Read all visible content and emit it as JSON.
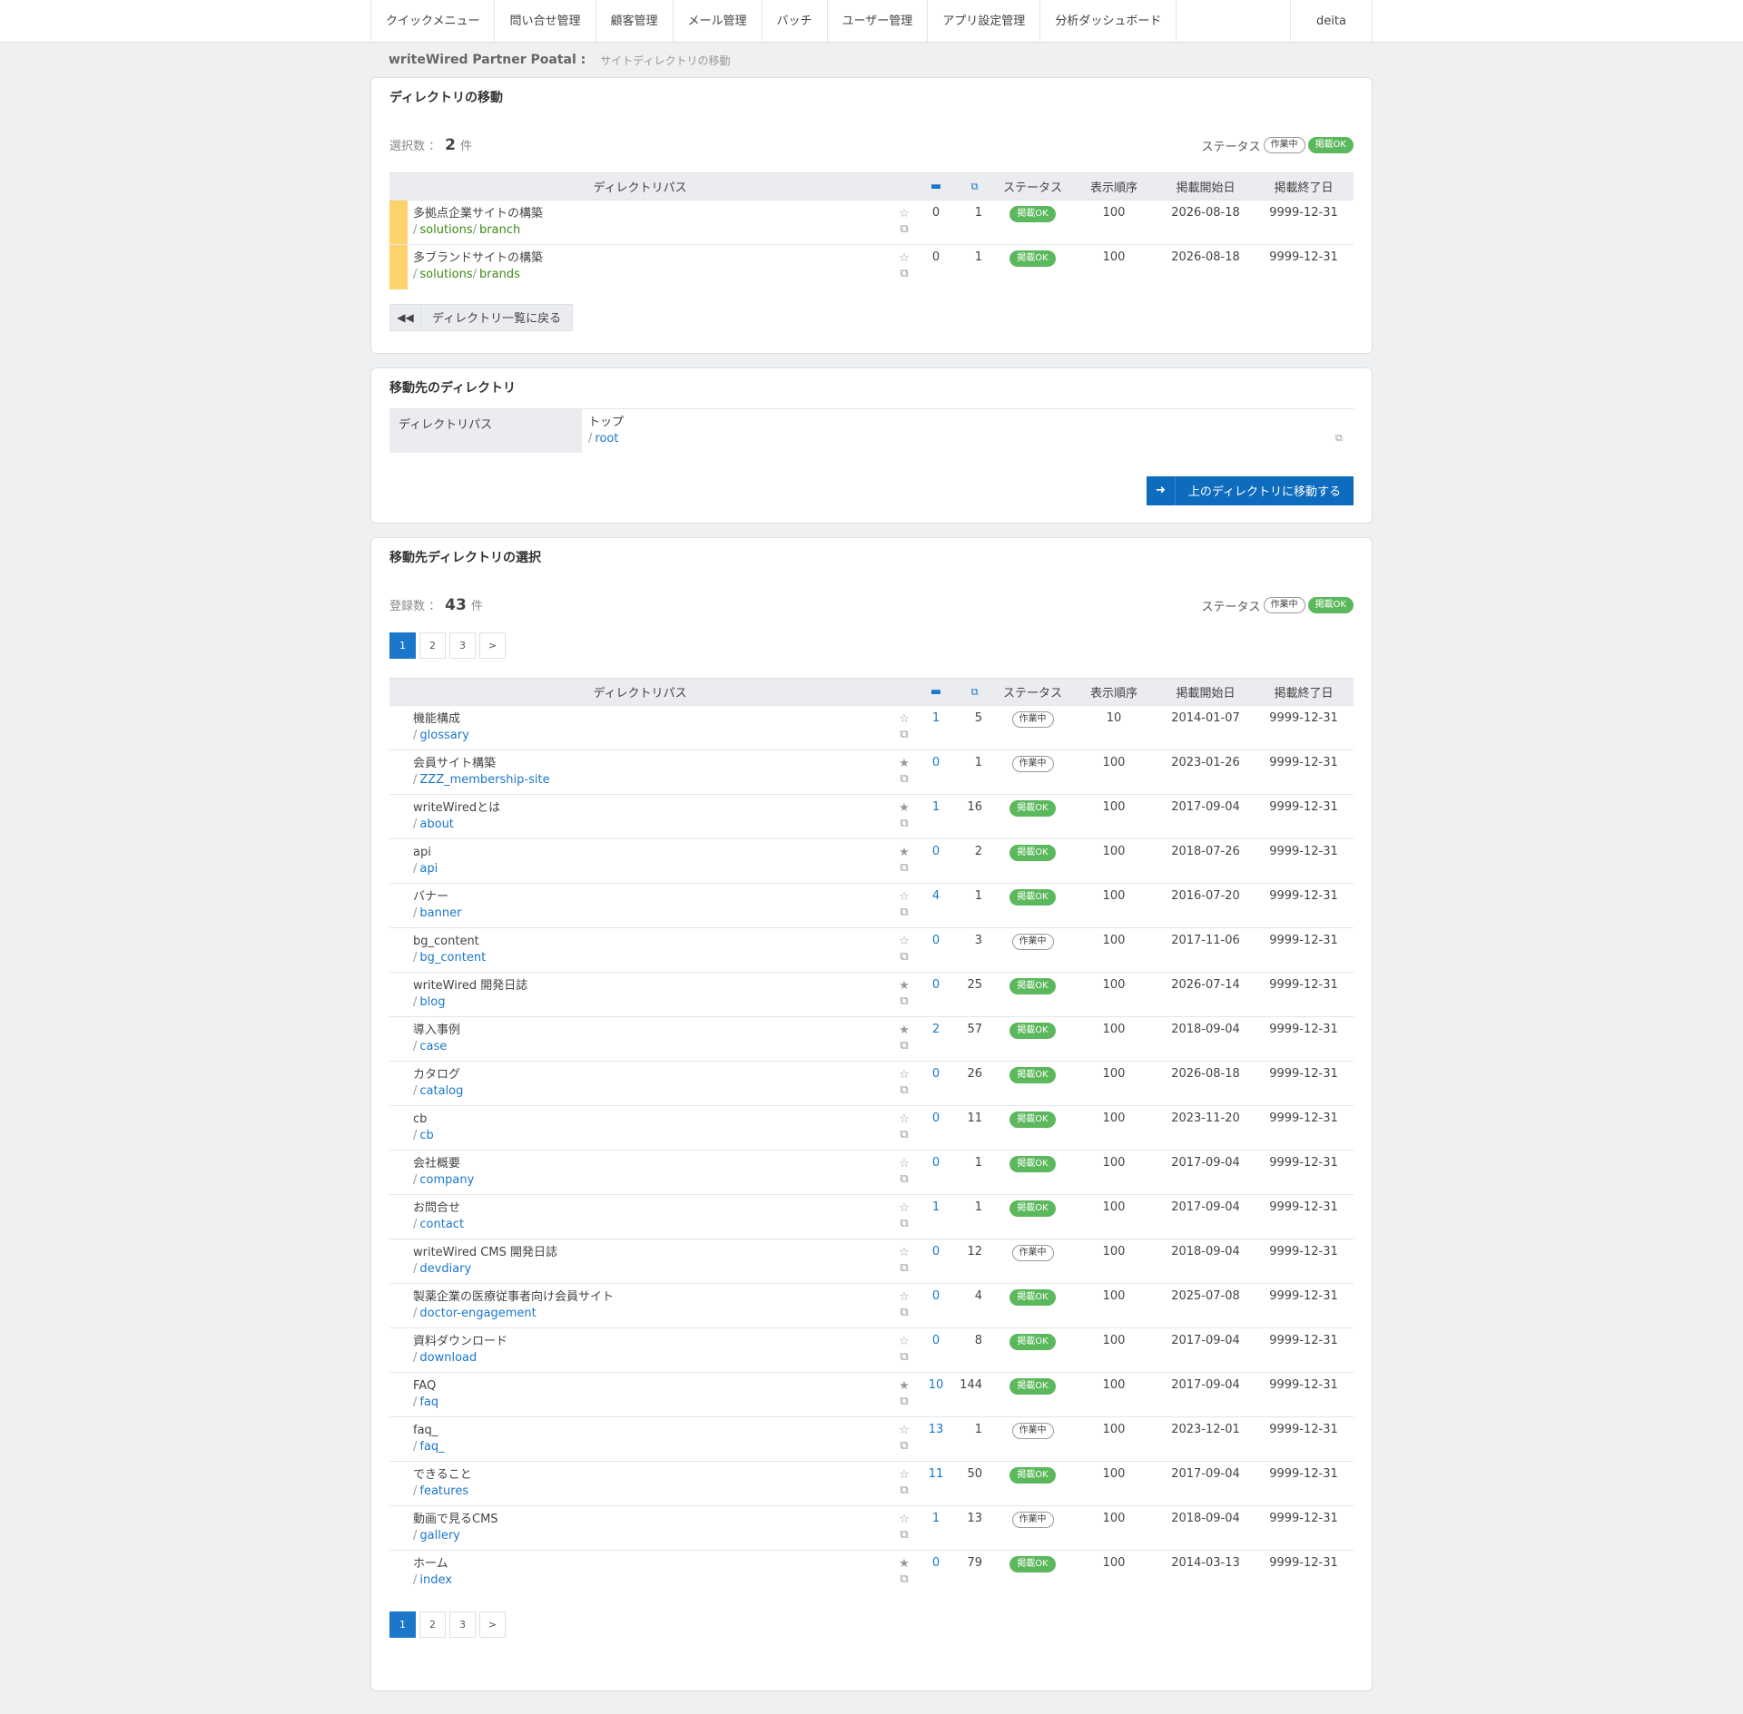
{
  "nav": {
    "items": [
      {
        "label": "クイックメニュー"
      },
      {
        "label": "問い合せ管理"
      },
      {
        "label": "顧客管理"
      },
      {
        "label": "メール管理"
      },
      {
        "label": "バッチ"
      },
      {
        "label": "ユーザー管理"
      },
      {
        "label": "アプリ設定管理"
      },
      {
        "label": "分析ダッシュボード"
      }
    ],
    "user": "deita"
  },
  "breadcrumb": {
    "site": "writeWired Partner Poatal :",
    "page": "サイトディレクトリの移動"
  },
  "status_legend": {
    "label": "ステータス",
    "wip": "作業中",
    "ok": "掲載OK"
  },
  "columns": {
    "path": "ディレクトリパス",
    "status": "ステータス",
    "order": "表示順序",
    "start": "掲載開始日",
    "end": "掲載終了日"
  },
  "move_panel": {
    "title": "ディレクトリの移動",
    "count_label": "選択数 ：",
    "count": "2",
    "count_unit": "件",
    "rows": [
      {
        "title": "多拠点企業サイトの構築",
        "path": [
          "solutions",
          "branch"
        ],
        "folders": "0",
        "pages": "1",
        "status": "ok",
        "order": "100",
        "start": "2026-08-18",
        "end": "9999-12-31"
      },
      {
        "title": "多ブランドサイトの構築",
        "path": [
          "solutions",
          "brands"
        ],
        "folders": "0",
        "pages": "1",
        "status": "ok",
        "order": "100",
        "start": "2026-08-18",
        "end": "9999-12-31"
      }
    ],
    "back_label": "ディレクトリ一覧に戻る"
  },
  "dest_panel": {
    "title": "移動先のディレクトリ",
    "label": "ディレクトリパス",
    "value_title": "トップ",
    "value_path": "root",
    "move_label": "上のディレクトリに移動する"
  },
  "select_panel": {
    "title": "移動先ディレクトリの選択",
    "count_label": "登録数 ：",
    "count": "43",
    "count_unit": "件",
    "pages": [
      "1",
      "2",
      "3",
      ">"
    ],
    "rows": [
      {
        "title": "機能構成",
        "path": "glossary",
        "starred": false,
        "folders": "1",
        "pages": "5",
        "status": "wip",
        "order": "10",
        "start": "2014-01-07",
        "end": "9999-12-31"
      },
      {
        "title": "会員サイト構築",
        "path": "ZZZ_membership-site",
        "starred": true,
        "folders": "0",
        "pages": "1",
        "status": "wip",
        "order": "100",
        "start": "2023-01-26",
        "end": "9999-12-31"
      },
      {
        "title": "writeWiredとは",
        "path": "about",
        "starred": true,
        "folders": "1",
        "pages": "16",
        "status": "ok",
        "order": "100",
        "start": "2017-09-04",
        "end": "9999-12-31"
      },
      {
        "title": "api",
        "path": "api",
        "starred": true,
        "folders": "0",
        "pages": "2",
        "status": "ok",
        "order": "100",
        "start": "2018-07-26",
        "end": "9999-12-31"
      },
      {
        "title": "バナー",
        "path": "banner",
        "starred": false,
        "folders": "4",
        "pages": "1",
        "status": "ok",
        "order": "100",
        "start": "2016-07-20",
        "end": "9999-12-31"
      },
      {
        "title": "bg_content",
        "path": "bg_content",
        "starred": false,
        "folders": "0",
        "pages": "3",
        "status": "wip",
        "order": "100",
        "start": "2017-11-06",
        "end": "9999-12-31"
      },
      {
        "title": "writeWired 開発日誌",
        "path": "blog",
        "starred": true,
        "folders": "0",
        "pages": "25",
        "status": "ok",
        "order": "100",
        "start": "2026-07-14",
        "end": "9999-12-31"
      },
      {
        "title": "導入事例",
        "path": "case",
        "starred": true,
        "folders": "2",
        "pages": "57",
        "status": "ok",
        "order": "100",
        "start": "2018-09-04",
        "end": "9999-12-31"
      },
      {
        "title": "カタログ",
        "path": "catalog",
        "starred": false,
        "folders": "0",
        "pages": "26",
        "status": "ok",
        "order": "100",
        "start": "2026-08-18",
        "end": "9999-12-31"
      },
      {
        "title": "cb",
        "path": "cb",
        "starred": false,
        "folders": "0",
        "pages": "11",
        "status": "ok",
        "order": "100",
        "start": "2023-11-20",
        "end": "9999-12-31"
      },
      {
        "title": "会社概要",
        "path": "company",
        "starred": false,
        "folders": "0",
        "pages": "1",
        "status": "ok",
        "order": "100",
        "start": "2017-09-04",
        "end": "9999-12-31"
      },
      {
        "title": "お問合せ",
        "path": "contact",
        "starred": false,
        "folders": "1",
        "pages": "1",
        "status": "ok",
        "order": "100",
        "start": "2017-09-04",
        "end": "9999-12-31"
      },
      {
        "title": "writeWired CMS 開発日誌",
        "path": "devdiary",
        "starred": false,
        "folders": "0",
        "pages": "12",
        "status": "wip",
        "order": "100",
        "start": "2018-09-04",
        "end": "9999-12-31"
      },
      {
        "title": "製薬企業の医療従事者向け会員サイト",
        "path": "doctor-engagement",
        "starred": false,
        "folders": "0",
        "pages": "4",
        "status": "ok",
        "order": "100",
        "start": "2025-07-08",
        "end": "9999-12-31"
      },
      {
        "title": "資料ダウンロード",
        "path": "download",
        "starred": false,
        "folders": "0",
        "pages": "8",
        "status": "ok",
        "order": "100",
        "start": "2017-09-04",
        "end": "9999-12-31"
      },
      {
        "title": "FAQ",
        "path": "faq",
        "starred": true,
        "folders": "10",
        "pages": "144",
        "status": "ok",
        "order": "100",
        "start": "2017-09-04",
        "end": "9999-12-31"
      },
      {
        "title": "faq_",
        "path": "faq_",
        "starred": false,
        "folders": "13",
        "pages": "1",
        "status": "wip",
        "order": "100",
        "start": "2023-12-01",
        "end": "9999-12-31"
      },
      {
        "title": "できること",
        "path": "features",
        "starred": false,
        "folders": "11",
        "pages": "50",
        "status": "ok",
        "order": "100",
        "start": "2017-09-04",
        "end": "9999-12-31"
      },
      {
        "title": "動画で見るCMS",
        "path": "gallery",
        "starred": false,
        "folders": "1",
        "pages": "13",
        "status": "wip",
        "order": "100",
        "start": "2018-09-04",
        "end": "9999-12-31"
      },
      {
        "title": "ホーム",
        "path": "index",
        "starred": true,
        "folders": "0",
        "pages": "79",
        "status": "ok",
        "order": "100",
        "start": "2014-03-13",
        "end": "9999-12-31"
      }
    ]
  },
  "icons": {
    "folder": "folder-icon",
    "pages": "pages-copy-icon",
    "star": "star-icon",
    "star_empty": "star-outline-icon",
    "copy": "copy-icon",
    "back": "fast-backward-icon",
    "move": "sign-in-icon"
  },
  "colors": {
    "accent": "#1a77c9",
    "status_ok": "#5cb85c",
    "selected_marker": "#fcd36a",
    "path_green": "#3c8a12"
  }
}
